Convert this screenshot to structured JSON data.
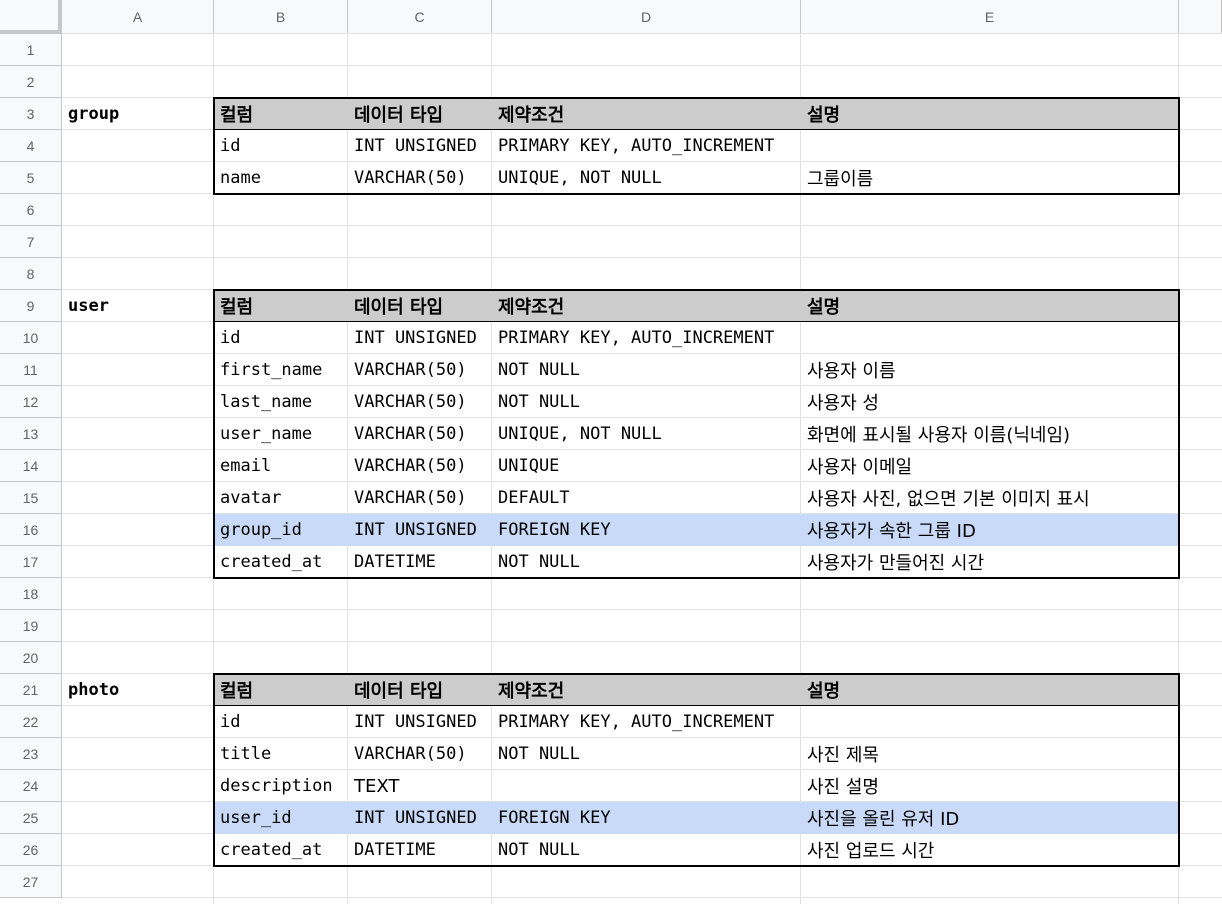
{
  "columns": [
    "A",
    "B",
    "C",
    "D",
    "E"
  ],
  "rows": [
    "1",
    "2",
    "3",
    "4",
    "5",
    "6",
    "7",
    "8",
    "9",
    "10",
    "11",
    "12",
    "13",
    "14",
    "15",
    "16",
    "17",
    "18",
    "19",
    "20",
    "21",
    "22",
    "23",
    "24",
    "25",
    "26",
    "27"
  ],
  "header_labels": [
    "컬럼",
    "데이터 타입",
    "제약조건",
    "설명"
  ],
  "colors": {
    "header_fill": "#cccccc",
    "foreign_key_fill": "#c9daf8",
    "grid": "#e2e2e2",
    "border": "#000000"
  },
  "tables": [
    {
      "name": "group",
      "rows": [
        [
          "id",
          "INT UNSIGNED",
          "PRIMARY KEY, AUTO_INCREMENT",
          ""
        ],
        [
          "name",
          "VARCHAR(50)",
          "UNIQUE, NOT NULL",
          "그룹이름"
        ]
      ]
    },
    {
      "name": "user",
      "rows": [
        [
          "id",
          "INT UNSIGNED",
          "PRIMARY KEY, AUTO_INCREMENT",
          ""
        ],
        [
          "first_name",
          "VARCHAR(50)",
          "NOT NULL",
          "사용자 이름"
        ],
        [
          "last_name",
          "VARCHAR(50)",
          "NOT NULL",
          "사용자 성"
        ],
        [
          "user_name",
          "VARCHAR(50)",
          "UNIQUE, NOT NULL",
          "화면에 표시될 사용자 이름(닉네임)"
        ],
        [
          "email",
          "VARCHAR(50)",
          "UNIQUE",
          "사용자 이메일"
        ],
        [
          "avatar",
          "VARCHAR(50)",
          "DEFAULT",
          "사용자 사진, 없으면 기본 이미지 표시"
        ],
        [
          "group_id",
          "INT UNSIGNED",
          "FOREIGN KEY",
          "사용자가 속한 그룹 ID"
        ],
        [
          "created_at",
          "DATETIME",
          "NOT NULL",
          "사용자가 만들어진 시간"
        ]
      ]
    },
    {
      "name": "photo",
      "rows": [
        [
          "id",
          "INT UNSIGNED",
          "PRIMARY KEY, AUTO_INCREMENT",
          ""
        ],
        [
          "title",
          "VARCHAR(50)",
          "NOT NULL",
          "사진 제목"
        ],
        [
          "description",
          "TEXT",
          "",
          "사진 설명"
        ],
        [
          "user_id",
          "INT UNSIGNED",
          "FOREIGN KEY",
          "사진을 올린 유저 ID"
        ],
        [
          "created_at",
          "DATETIME",
          "NOT NULL",
          "사진 업로드 시간"
        ]
      ]
    }
  ]
}
